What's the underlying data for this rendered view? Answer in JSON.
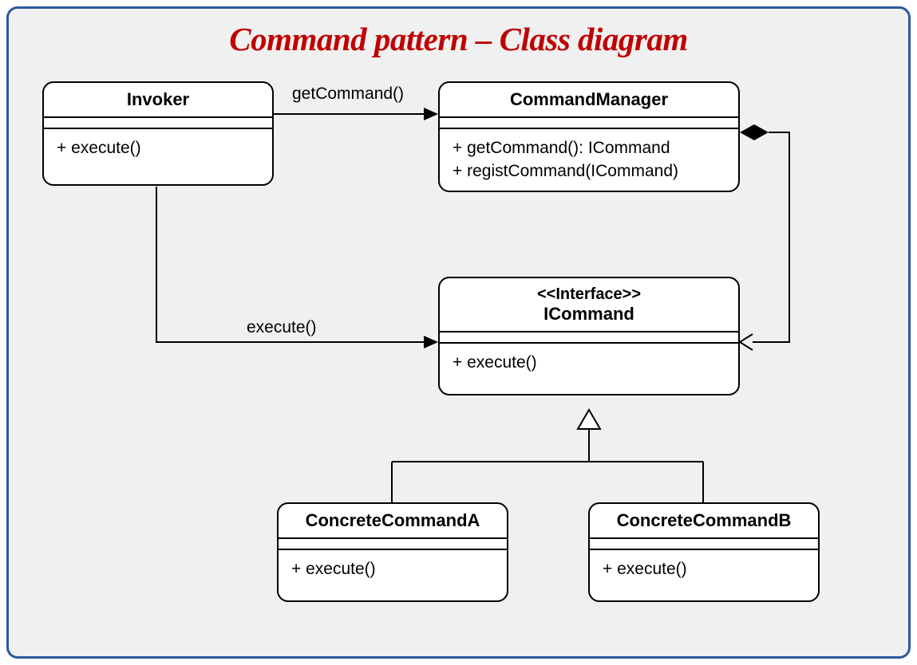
{
  "title": "Command pattern – Class diagram",
  "classes": {
    "invoker": {
      "name": "Invoker",
      "ops": [
        "+ execute()"
      ]
    },
    "commandManager": {
      "name": "CommandManager",
      "ops": [
        "+ getCommand(): ICommand",
        "+ registCommand(ICommand)"
      ]
    },
    "iCommand": {
      "stereotype": "<<Interface>>",
      "name": "ICommand",
      "ops": [
        "+ execute()"
      ]
    },
    "concreteA": {
      "name": "ConcreteCommandA",
      "ops": [
        "+ execute()"
      ]
    },
    "concreteB": {
      "name": "ConcreteCommandB",
      "ops": [
        "+ execute()"
      ]
    }
  },
  "relations": {
    "invokerToManager": {
      "label": "getCommand()"
    },
    "invokerToICommand": {
      "label": "execute()"
    }
  }
}
